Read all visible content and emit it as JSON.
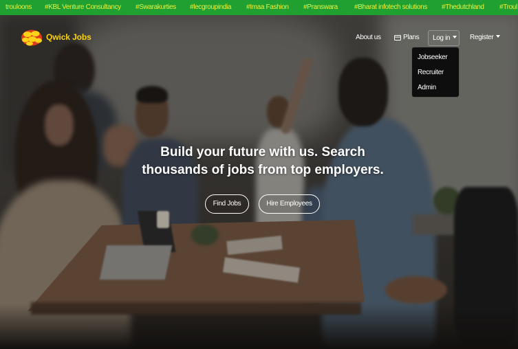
{
  "ticker": {
    "items": [
      "trouloons",
      "#KBL Venture Consultancy",
      "#Swarakurties",
      "#lecgroupindia",
      "#Imaa Fashion",
      "#Pranswara",
      "#Bharat infotech solutions",
      "#Thedutchland",
      "#Troul"
    ]
  },
  "navbar": {
    "brand_name": "Qwick Jobs",
    "brand_logo_icon": "qwick-jobs-logo-icon",
    "links": {
      "about": "About us",
      "plans": "Plans",
      "plans_icon": "card-icon",
      "login": "Log in",
      "register": "Register",
      "dropdown_icon": "chevron-down-icon"
    },
    "login_menu": {
      "open": true,
      "items": [
        "Jobseeker",
        "Recruiter",
        "Admin"
      ]
    }
  },
  "hero": {
    "heading_line1": "Build your future with us. Search",
    "heading_line2": "thousands of jobs from top employers.",
    "buttons": {
      "find_jobs": "Find Jobs",
      "hire_employees": "Hire Employees"
    }
  },
  "colors": {
    "ticker_background": "#20a030",
    "ticker_text": "#eef03a",
    "brand": "#f7d20c",
    "text": "#ffffff",
    "dropdown_background": "#0e0e0e"
  }
}
